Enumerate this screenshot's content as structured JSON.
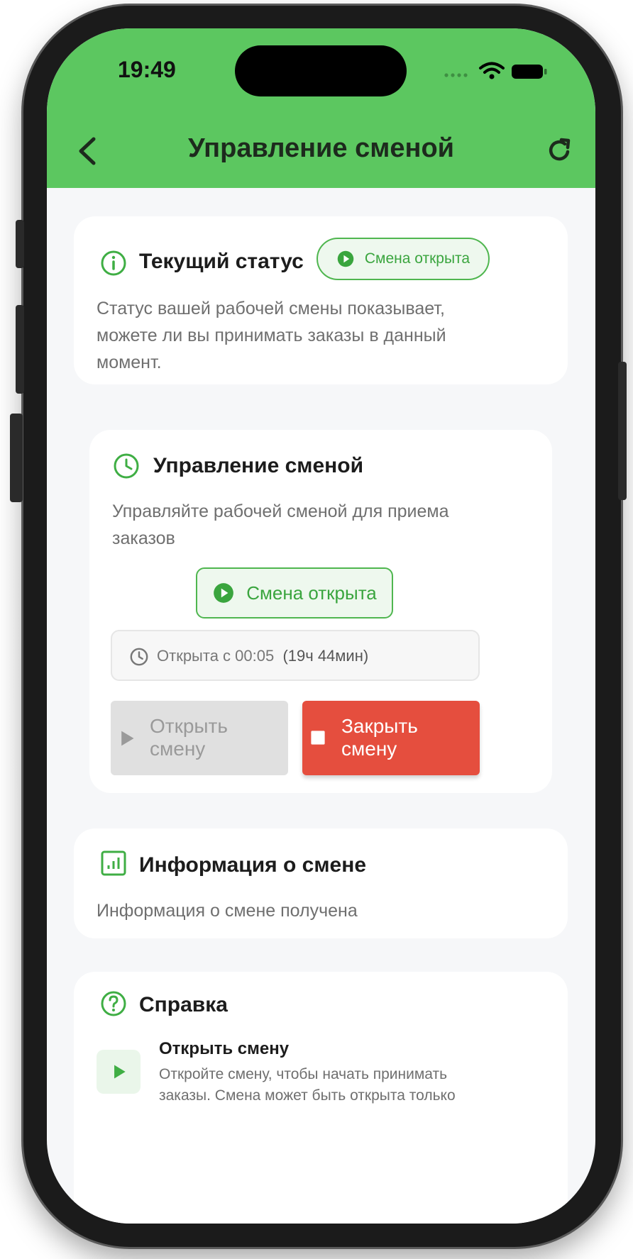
{
  "status_bar": {
    "time": "19:49"
  },
  "nav": {
    "title": "Управление сменой"
  },
  "status_card": {
    "title": "Текущий статус",
    "badge": "Смена открыта",
    "description": "Статус вашей рабочей смены показывает, можете ли вы принимать заказы в данный момент."
  },
  "shift_card": {
    "title": "Управление сменой",
    "description": "Управляйте рабочей сменой для приема заказов",
    "badge": "Смена открыта",
    "opened_since": "Открыта с 00:05",
    "duration": "(19ч 44мин)",
    "open_button": "Открыть смену",
    "close_button": "Закрыть смену"
  },
  "info_card": {
    "title": "Информация о смене",
    "text": "Информация о смене получена"
  },
  "help_card": {
    "title": "Справка",
    "item_title": "Открыть смену",
    "item_text": "Откройте смену, чтобы начать принимать заказы. Смена может быть открыта только"
  },
  "colors": {
    "header": "#5cc760",
    "accent_green": "#3aa53e",
    "close_red": "#e54e3e"
  },
  "icons": {
    "back": "chevron-left-icon",
    "refresh": "refresh-icon",
    "info": "info-icon",
    "clock": "clock-icon",
    "play": "play-icon",
    "stop": "stop-icon",
    "stats": "chart-icon",
    "help": "help-icon"
  }
}
